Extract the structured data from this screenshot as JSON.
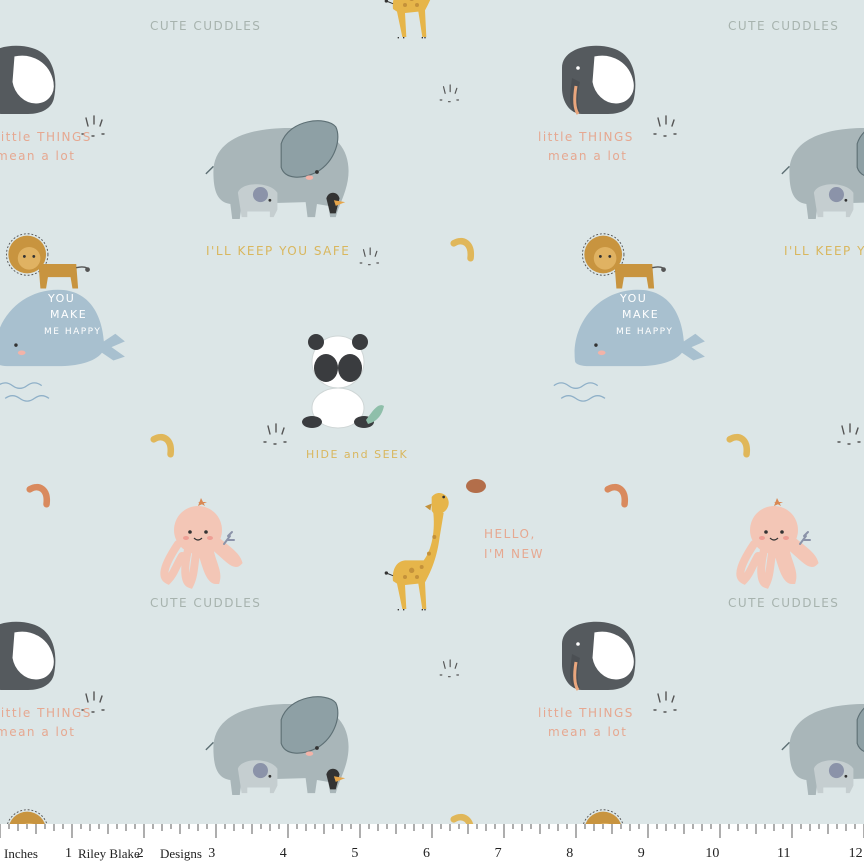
{
  "phrases": {
    "cuddles": "CUTE CUDDLES",
    "little_things_1": "little THINGS",
    "little_things_2": "mean a lot",
    "keep_safe": "I'LL KEEP YOU SAFE",
    "whale_1": "YOU",
    "whale_2": "MAKE",
    "whale_3": "ME HAPPY",
    "hide_seek": "HIDE and SEEK",
    "hello_1": "HELLO,",
    "hello_2": "I'M NEW"
  },
  "ruler": {
    "unit": "Inches",
    "brand_1": "Riley Blake",
    "brand_2": "Designs",
    "numbers": [
      "1",
      "2",
      "3",
      "4",
      "5",
      "6",
      "7",
      "8",
      "9",
      "10",
      "11",
      "12"
    ]
  },
  "colors": {
    "background": "#dce6e7",
    "elephant": "#a9b6b9",
    "giraffe": "#e6b54a",
    "whale": "#a8c0cf",
    "octopus": "#f3c6b6",
    "lion": "#c8943f",
    "text_pink": "#e6a891",
    "text_gray": "#a7b3ae",
    "text_yellow": "#d9b75e"
  }
}
